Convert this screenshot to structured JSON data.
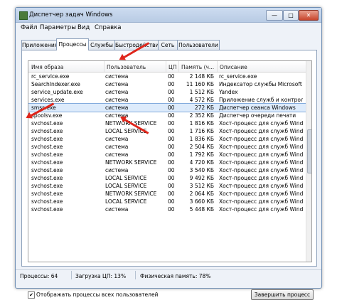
{
  "window": {
    "title": "Диспетчер задач Windows",
    "min": "—",
    "max": "□",
    "close": "✕"
  },
  "menu": [
    "Файл",
    "Параметры",
    "Вид",
    "Справка"
  ],
  "tabs": [
    "Приложения",
    "Процессы",
    "Службы",
    "Быстродействие",
    "Сеть",
    "Пользователи"
  ],
  "active_tab": "Процессы",
  "columns": [
    "Имя образа",
    "Пользователь",
    "ЦП",
    "Память (ч...",
    "Описание"
  ],
  "rows": [
    {
      "name": "rc_service.exe",
      "user": "система",
      "cpu": "00",
      "mem": "2 148 КБ",
      "desc": "rc_service.exe"
    },
    {
      "name": "SearchIndexer.exe",
      "user": "система",
      "cpu": "00",
      "mem": "11 160 КБ",
      "desc": "Индексатор службы Microsoft W"
    },
    {
      "name": "service_update.exe",
      "user": "система",
      "cpu": "00",
      "mem": "1 512 КБ",
      "desc": "Yandex"
    },
    {
      "name": "services.exe",
      "user": "система",
      "cpu": "00",
      "mem": "4 572 КБ",
      "desc": "Приложение служб и контролле"
    },
    {
      "name": "smss.exe",
      "user": "система",
      "cpu": "00",
      "mem": "272 КБ",
      "desc": "Диспетчер сеанса  Windows"
    },
    {
      "name": "spoolsv.exe",
      "user": "система",
      "cpu": "00",
      "mem": "2 352 КБ",
      "desc": "Диспетчер очереди печати"
    },
    {
      "name": "svchost.exe",
      "user": "NETWORK SERVICE",
      "cpu": "00",
      "mem": "1 816 КБ",
      "desc": "Хост-процесс для служб Windows"
    },
    {
      "name": "svchost.exe",
      "user": "LOCAL SERVICE",
      "cpu": "00",
      "mem": "1 716 КБ",
      "desc": "Хост-процесс для служб Windows"
    },
    {
      "name": "svchost.exe",
      "user": "система",
      "cpu": "00",
      "mem": "1 836 КБ",
      "desc": "Хост-процесс для служб Windows"
    },
    {
      "name": "svchost.exe",
      "user": "система",
      "cpu": "00",
      "mem": "2 504 КБ",
      "desc": "Хост-процесс для служб Windows"
    },
    {
      "name": "svchost.exe",
      "user": "система",
      "cpu": "00",
      "mem": "1 792 КБ",
      "desc": "Хост-процесс для служб Windows"
    },
    {
      "name": "svchost.exe",
      "user": "NETWORK SERVICE",
      "cpu": "00",
      "mem": "4 720 КБ",
      "desc": "Хост-процесс для служб Windows"
    },
    {
      "name": "svchost.exe",
      "user": "система",
      "cpu": "00",
      "mem": "3 540 КБ",
      "desc": "Хост-процесс для служб Windows"
    },
    {
      "name": "svchost.exe",
      "user": "LOCAL SERVICE",
      "cpu": "00",
      "mem": "9 492 КБ",
      "desc": "Хост-процесс для служб Windows"
    },
    {
      "name": "svchost.exe",
      "user": "LOCAL SERVICE",
      "cpu": "00",
      "mem": "3 512 КБ",
      "desc": "Хост-процесс для служб Windows"
    },
    {
      "name": "svchost.exe",
      "user": "NETWORK SERVICE",
      "cpu": "00",
      "mem": "2 064 КБ",
      "desc": "Хост-процесс для служб Windows"
    },
    {
      "name": "svchost.exe",
      "user": "LOCAL SERVICE",
      "cpu": "00",
      "mem": "3 660 КБ",
      "desc": "Хост-процесс для служб Windows"
    },
    {
      "name": "svchost.exe",
      "user": "система",
      "cpu": "00",
      "mem": "5 448 КБ",
      "desc": "Хост-процесс для служб Windows"
    }
  ],
  "selected_row": "smss.exe",
  "show_all_users": {
    "label": "Отображать процессы всех пользователей",
    "checked": "✔"
  },
  "end_process_button": "Завершить процесс",
  "status": {
    "processes": "Процессы: 64",
    "cpu": "Загрузка ЦП: 13%",
    "memory": "Физическая память: 78%"
  },
  "colors": {
    "accent_selection": "#ddebfb",
    "arrow": "#e0261b",
    "title_bar": "#cddcf0"
  }
}
